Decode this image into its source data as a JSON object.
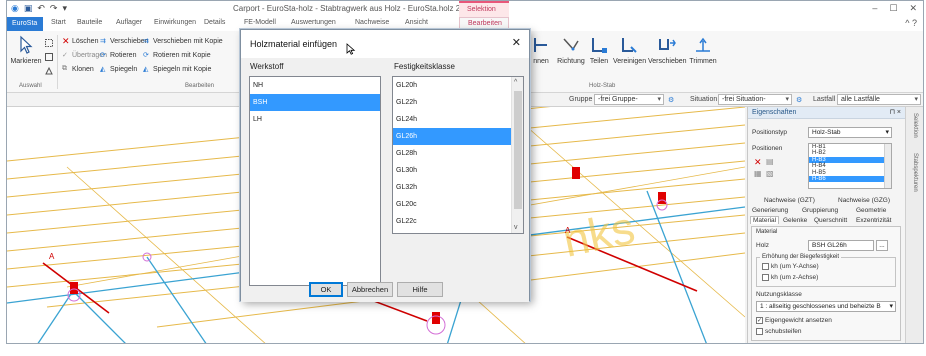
{
  "window": {
    "title": "Carport - EuroSta-holz - Stabtragwerk aus Holz - EuroSta.holz 2017",
    "context_group": "Selektion",
    "minimize": "–",
    "maximize": "☐",
    "close": "✕",
    "qat_icons": [
      "app-icon",
      "save-icon",
      "undo-icon",
      "redo-icon",
      "customize-icon"
    ]
  },
  "ribbon_tabs": {
    "file": "EuroSta",
    "items": [
      "Start",
      "Bauteile",
      "Auflager",
      "Einwirkungen",
      "Details",
      "FE-Modell",
      "Auswertungen",
      "Nachweise",
      "Ansicht"
    ],
    "context": "Bearbeiten",
    "help": "^  ?"
  },
  "ribbon": {
    "auswahl": {
      "markieren": "Markieren",
      "group_label": "Auswahl"
    },
    "bearbeiten": {
      "loeschen": "Löschen",
      "uebertragen": "Übertragen",
      "klonen": "Klonen",
      "verschieben": "Verschieben",
      "rotieren": "Rotieren",
      "spiegeln": "Spiegeln",
      "verschieben_kopie": "Verschieben mit Kopie",
      "rotieren_kopie": "Rotieren mit Kopie",
      "spiegeln_kopie": "Spiegeln mit Kopie",
      "group_label": "Bearbeiten"
    },
    "holzstab": {
      "items": [
        "nnen",
        "Richtung",
        "Teilen",
        "Vereinigen",
        "Verschieben",
        "Trimmen"
      ],
      "group_label": "Holz-Stab"
    }
  },
  "toolbar2": {
    "gruppe_label": "Gruppe",
    "gruppe_value": "-frei Gruppe-",
    "situation_label": "Situation",
    "situation_value": "-frei Situation-",
    "lastfall_label": "Lastfall",
    "lastfall_value": "alle Lastfälle"
  },
  "viewport": {
    "axis_labels": [
      "A",
      "A"
    ],
    "watermark": "nks"
  },
  "properties": {
    "title": "Eigenschaften",
    "pin": "⊓ ×",
    "positionstyp_label": "Positionstyp",
    "positionstyp_value": "Holz-Stab",
    "positionen_label": "Positionen",
    "positionen": [
      "H-B1",
      "H-B2",
      "H-B3",
      "H-B4",
      "H-B5",
      "H-B6"
    ],
    "positionen_selected": [
      2,
      5
    ],
    "tabs_row1": [
      "Nachweise (GZT)",
      "Nachweise (GZG)"
    ],
    "tabs_row2": [
      "Generierung",
      "Gruppierung",
      "Geometrie"
    ],
    "tabs_row3": [
      "Material",
      "Gelenke",
      "Querschnitt",
      "Exzentrizität"
    ],
    "material_heading": "Material",
    "holz_label": "Holz",
    "holz_value": "BSH GL26h",
    "holz_button": "...",
    "erhoehung_label": "Erhöhung der Biegefestigkeit",
    "kh_y": "kh (um Y-Achse)",
    "kh_z": "kh (um z-Achse)",
    "nutzungsklasse_label": "Nutzungsklasse",
    "nutzungsklasse_value": "1 : allseitig geschlossenes und beheizte B",
    "eigengewicht": "Eigengewicht ansetzen",
    "schubstaebe": "schubsteifen"
  },
  "side_strip": {
    "items": [
      "Selektion",
      "Stabspekturen"
    ]
  },
  "dialog": {
    "title": "Holzmaterial einfügen",
    "close": "✕",
    "werkstoff_label": "Werkstoff",
    "werkstoff": [
      "NH",
      "BSH",
      "LH"
    ],
    "werkstoff_selected": 1,
    "festigkeit_label": "Festigkeitsklasse",
    "festigkeit": [
      "GL20h",
      "GL22h",
      "GL24h",
      "GL26h",
      "GL28h",
      "GL30h",
      "GL32h",
      "GL20c",
      "GL22c"
    ],
    "festigkeit_selected": 3,
    "ok": "OK",
    "abbrechen": "Abbrechen",
    "hilfe": "Hilfe"
  },
  "colors": {
    "accent": "#2a7bd5",
    "selection": "#3399ff",
    "context_tab": "#e8577a",
    "support_red": "#e00000",
    "beam_line": "#e6b94a",
    "member_line": "#3aa3d2"
  }
}
